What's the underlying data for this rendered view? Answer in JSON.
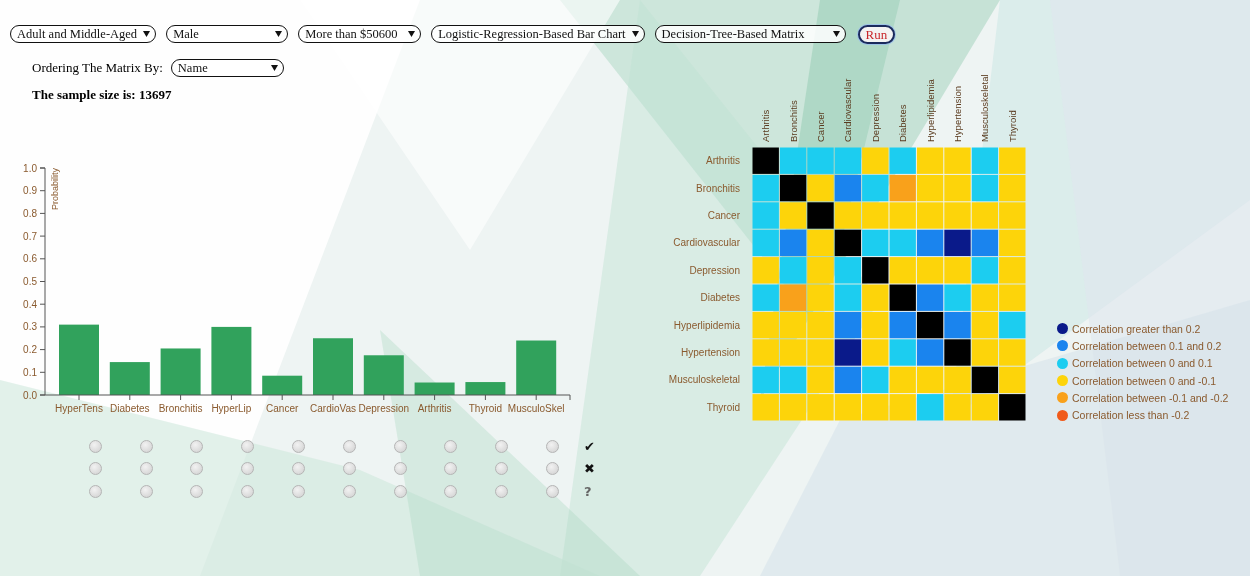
{
  "filters": [
    {
      "value": "Adult and Middle-Aged"
    },
    {
      "value": "Male"
    },
    {
      "value": "More than $50600"
    },
    {
      "value": "Logistic-Regression-Based Bar Chart"
    },
    {
      "value": "Decision-Tree-Based Matrix"
    }
  ],
  "run_button": "Run",
  "ordering": {
    "label": "Ordering The Matrix By:",
    "value": "Name"
  },
  "sample_size": "The sample size is: 13697",
  "bar_chart": {
    "chart_data": {
      "type": "bar",
      "ylabel": "Probability",
      "categories": [
        "HyperTens",
        "Diabetes",
        "Bronchitis",
        "HyperLip",
        "Cancer",
        "CardioVas",
        "Depression",
        "Arthritis",
        "Thyroid",
        "MusculoSkel"
      ],
      "values": [
        0.31,
        0.145,
        0.205,
        0.3,
        0.085,
        0.25,
        0.175,
        0.055,
        0.057,
        0.24
      ],
      "ylim": [
        0,
        1
      ],
      "yticks": [
        {
          "value": 0,
          "label": "0.0"
        },
        {
          "value": 0.1,
          "label": "0.1"
        },
        {
          "value": 0.2,
          "label": "0.2"
        },
        {
          "value": 0.3,
          "label": "0.3"
        },
        {
          "value": 0.4,
          "label": "0.4"
        },
        {
          "value": 0.5,
          "label": "0.5"
        },
        {
          "value": 0.6,
          "label": "0.6"
        },
        {
          "value": 0.7,
          "label": "0.7"
        },
        {
          "value": 0.8,
          "label": "0.8"
        },
        {
          "value": 0.9,
          "label": "0.9"
        },
        {
          "value": 1,
          "label": "1.0"
        }
      ]
    }
  },
  "answer_rows": [
    {
      "symbol": "✔",
      "options": [
        {
          "selected": false
        },
        {
          "selected": false
        },
        {
          "selected": false
        },
        {
          "selected": false
        },
        {
          "selected": false
        },
        {
          "selected": false
        },
        {
          "selected": false
        },
        {
          "selected": false
        },
        {
          "selected": false
        },
        {
          "selected": false
        }
      ]
    },
    {
      "symbol": "✖",
      "options": [
        {
          "selected": false
        },
        {
          "selected": false
        },
        {
          "selected": false
        },
        {
          "selected": false
        },
        {
          "selected": false
        },
        {
          "selected": false
        },
        {
          "selected": false
        },
        {
          "selected": false
        },
        {
          "selected": false
        },
        {
          "selected": false
        }
      ]
    },
    {
      "symbol": "?",
      "options": [
        {
          "selected": false
        },
        {
          "selected": false
        },
        {
          "selected": false
        },
        {
          "selected": false
        },
        {
          "selected": false
        },
        {
          "selected": false
        },
        {
          "selected": false
        },
        {
          "selected": false
        },
        {
          "selected": false
        },
        {
          "selected": false
        }
      ]
    }
  ],
  "matrix": {
    "columns": [
      "Arthritis",
      "Bronchitis",
      "Cancer",
      "Cardiovascular",
      "Depression",
      "Diabetes",
      "Hyperlipidemia",
      "Hypertension",
      "Musculoskeletal",
      "Thyroid"
    ],
    "rows": [
      {
        "label": "Arthritis",
        "cells": [
          {
            "color": "#000000"
          },
          {
            "color": "#1ccdf0"
          },
          {
            "color": "#1ccdf0"
          },
          {
            "color": "#1ccdf0"
          },
          {
            "color": "#fdd40a"
          },
          {
            "color": "#1ccdf0"
          },
          {
            "color": "#fdd40a"
          },
          {
            "color": "#fdd40a"
          },
          {
            "color": "#1ccdf0"
          },
          {
            "color": "#fdd40a"
          }
        ]
      },
      {
        "label": "Bronchitis",
        "cells": [
          {
            "color": "#1ccdf0"
          },
          {
            "color": "#000000"
          },
          {
            "color": "#fdd40a"
          },
          {
            "color": "#1a84ee"
          },
          {
            "color": "#1ccdf0"
          },
          {
            "color": "#f9a11b"
          },
          {
            "color": "#fdd40a"
          },
          {
            "color": "#fdd40a"
          },
          {
            "color": "#1ccdf0"
          },
          {
            "color": "#fdd40a"
          }
        ]
      },
      {
        "label": "Cancer",
        "cells": [
          {
            "color": "#1ccdf0"
          },
          {
            "color": "#fdd40a"
          },
          {
            "color": "#000000"
          },
          {
            "color": "#fdd40a"
          },
          {
            "color": "#fdd40a"
          },
          {
            "color": "#fdd40a"
          },
          {
            "color": "#fdd40a"
          },
          {
            "color": "#fdd40a"
          },
          {
            "color": "#fdd40a"
          },
          {
            "color": "#fdd40a"
          }
        ]
      },
      {
        "label": "Cardiovascular",
        "cells": [
          {
            "color": "#1ccdf0"
          },
          {
            "color": "#1a84ee"
          },
          {
            "color": "#fdd40a"
          },
          {
            "color": "#000000"
          },
          {
            "color": "#1ccdf0"
          },
          {
            "color": "#1ccdf0"
          },
          {
            "color": "#1a84ee"
          },
          {
            "color": "#0a1a8a"
          },
          {
            "color": "#1a84ee"
          },
          {
            "color": "#fdd40a"
          }
        ]
      },
      {
        "label": "Depression",
        "cells": [
          {
            "color": "#fdd40a"
          },
          {
            "color": "#1ccdf0"
          },
          {
            "color": "#fdd40a"
          },
          {
            "color": "#1ccdf0"
          },
          {
            "color": "#000000"
          },
          {
            "color": "#fdd40a"
          },
          {
            "color": "#fdd40a"
          },
          {
            "color": "#fdd40a"
          },
          {
            "color": "#1ccdf0"
          },
          {
            "color": "#fdd40a"
          }
        ]
      },
      {
        "label": "Diabetes",
        "cells": [
          {
            "color": "#1ccdf0"
          },
          {
            "color": "#f9a11b"
          },
          {
            "color": "#fdd40a"
          },
          {
            "color": "#1ccdf0"
          },
          {
            "color": "#fdd40a"
          },
          {
            "color": "#000000"
          },
          {
            "color": "#1a84ee"
          },
          {
            "color": "#1ccdf0"
          },
          {
            "color": "#fdd40a"
          },
          {
            "color": "#fdd40a"
          }
        ]
      },
      {
        "label": "Hyperlipidemia",
        "cells": [
          {
            "color": "#fdd40a"
          },
          {
            "color": "#fdd40a"
          },
          {
            "color": "#fdd40a"
          },
          {
            "color": "#1a84ee"
          },
          {
            "color": "#fdd40a"
          },
          {
            "color": "#1a84ee"
          },
          {
            "color": "#000000"
          },
          {
            "color": "#1a84ee"
          },
          {
            "color": "#fdd40a"
          },
          {
            "color": "#1ccdf0"
          }
        ]
      },
      {
        "label": "Hypertension",
        "cells": [
          {
            "color": "#fdd40a"
          },
          {
            "color": "#fdd40a"
          },
          {
            "color": "#fdd40a"
          },
          {
            "color": "#0a1a8a"
          },
          {
            "color": "#fdd40a"
          },
          {
            "color": "#1ccdf0"
          },
          {
            "color": "#1a84ee"
          },
          {
            "color": "#000000"
          },
          {
            "color": "#fdd40a"
          },
          {
            "color": "#fdd40a"
          }
        ]
      },
      {
        "label": "Musculoskeletal",
        "cells": [
          {
            "color": "#1ccdf0"
          },
          {
            "color": "#1ccdf0"
          },
          {
            "color": "#fdd40a"
          },
          {
            "color": "#1a84ee"
          },
          {
            "color": "#1ccdf0"
          },
          {
            "color": "#fdd40a"
          },
          {
            "color": "#fdd40a"
          },
          {
            "color": "#fdd40a"
          },
          {
            "color": "#000000"
          },
          {
            "color": "#fdd40a"
          }
        ]
      },
      {
        "label": "Thyroid",
        "cells": [
          {
            "color": "#fdd40a"
          },
          {
            "color": "#fdd40a"
          },
          {
            "color": "#fdd40a"
          },
          {
            "color": "#fdd40a"
          },
          {
            "color": "#fdd40a"
          },
          {
            "color": "#fdd40a"
          },
          {
            "color": "#1ccdf0"
          },
          {
            "color": "#fdd40a"
          },
          {
            "color": "#fdd40a"
          },
          {
            "color": "#000000"
          }
        ]
      }
    ]
  },
  "legend": [
    {
      "label": "Correlation greater than 0.2",
      "color": "#0a1a8a"
    },
    {
      "label": "Correlation between 0.1 and 0.2",
      "color": "#1a84ee"
    },
    {
      "label": "Correlation between 0 and 0.1",
      "color": "#1ccdf0"
    },
    {
      "label": "Correlation between 0 and -0.1",
      "color": "#fdd40a"
    },
    {
      "label": "Correlation between -0.1 and -0.2",
      "color": "#f9a11b"
    },
    {
      "label": "Correlation less than -0.2",
      "color": "#f05a1a"
    }
  ]
}
